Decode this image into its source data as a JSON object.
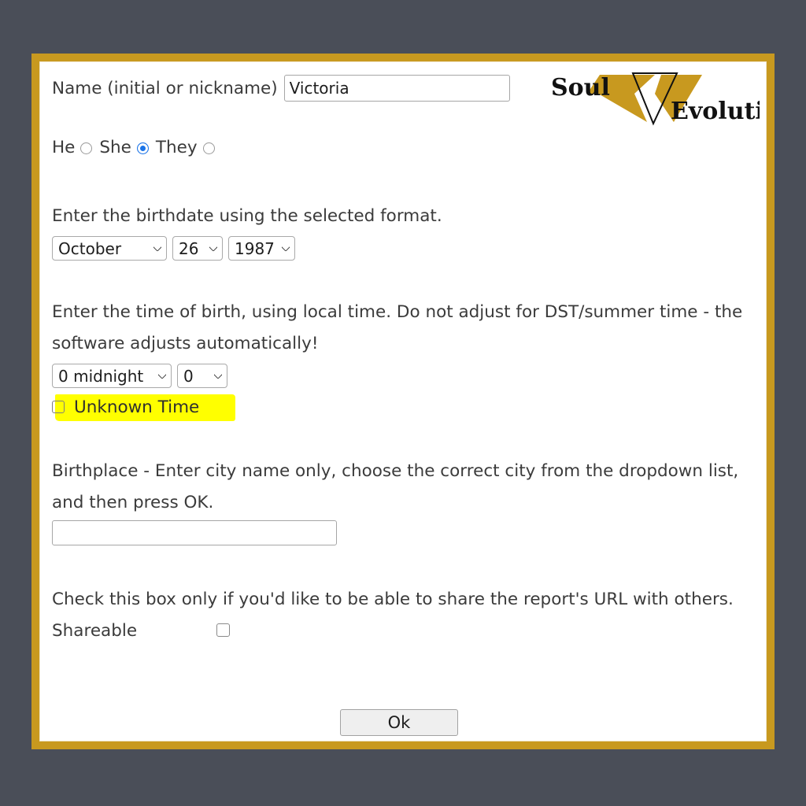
{
  "theme": {
    "page_background": "#4a4e58",
    "frame_gold": "#c8991f",
    "card_background": "#ffffff",
    "text_color": "#3b3b3b",
    "highlight_yellow": "#ffff00",
    "radio_selected_blue": "#1a73e8"
  },
  "logo": {
    "word_left": "Soul",
    "word_right": "Evolution",
    "mark_name": "v-chevron-mark",
    "gold": "#c8991f"
  },
  "form": {
    "name": {
      "label": "Name (initial or nickname)",
      "value": "Victoria",
      "placeholder": ""
    },
    "pronouns": {
      "options": [
        {
          "label": "He",
          "selected": false
        },
        {
          "label": "She",
          "selected": true
        },
        {
          "label": "They",
          "selected": false
        }
      ]
    },
    "birthdate": {
      "instruction": "Enter the birthdate using the selected format.",
      "month": "October",
      "day": "26",
      "year": "1987"
    },
    "birthtime": {
      "instruction": "Enter the time of birth, using local time. Do not adjust for DST/summer time - the software adjusts automatically!",
      "hour": "0 midnight",
      "minute": "0",
      "unknown_time_label": "Unknown Time",
      "unknown_time_checked": false
    },
    "birthplace": {
      "instruction": "Birthplace - Enter city name only, choose the correct city from the dropdown list, and then press OK.",
      "value": "",
      "placeholder": ""
    },
    "shareable": {
      "instruction": "Check this box only if you'd like to be able to share the report's URL with others. Shareable",
      "checked": false
    },
    "submit_label": "Ok"
  }
}
